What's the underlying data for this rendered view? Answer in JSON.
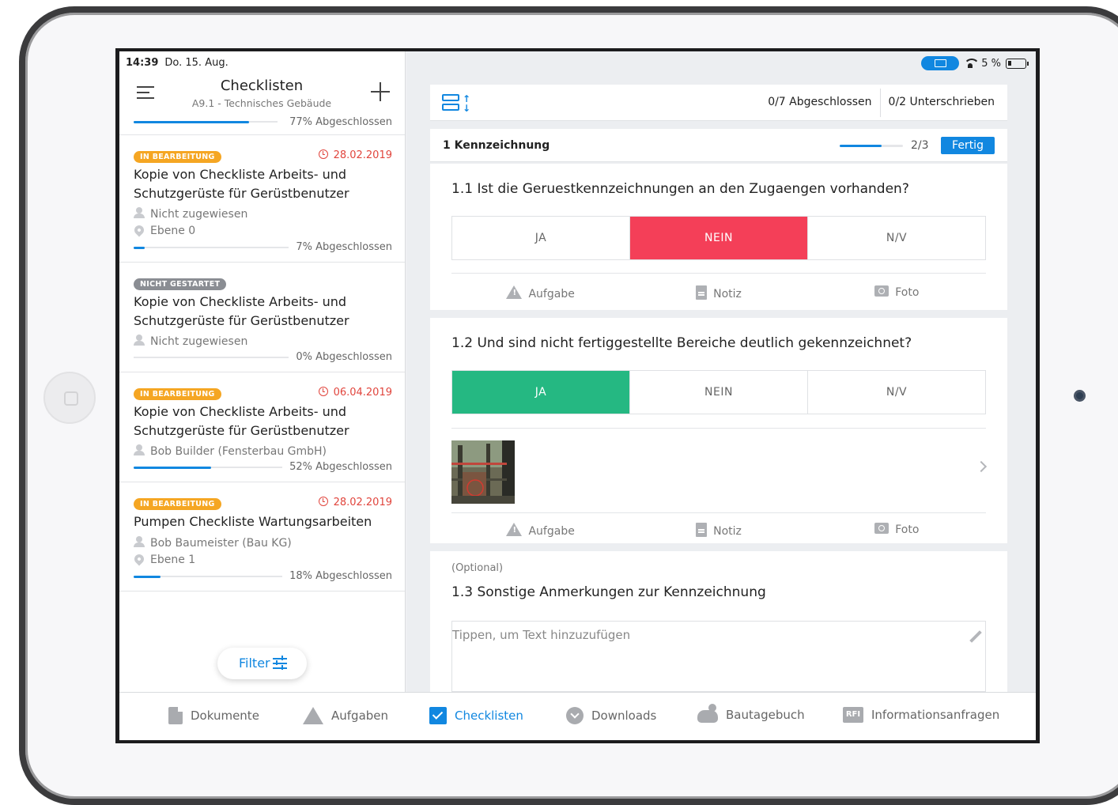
{
  "status": {
    "time": "14:39",
    "date": "Do. 15. Aug.",
    "battery": "5 %"
  },
  "header": {
    "title": "Checklisten",
    "subtitle": "A9.1 - Technisches Gebäude"
  },
  "list": {
    "top_progress_label": "77% Abgeschlossen",
    "top_progress": 0.77,
    "items": [
      {
        "badge": "IN BEARBEITUNG",
        "date": "28.02.2019",
        "title": "Kopie von Checkliste Arbeits- und Schutzgerüste für Gerüstbenutzer",
        "assignee": "Nicht zugewiesen",
        "location": "Ebene 0",
        "progress_label": "7% Abgeschlossen",
        "progress": 0.07
      },
      {
        "badge": "NICHT GESTARTET",
        "title": "Kopie von Checkliste Arbeits- und Schutzgerüste für Gerüstbenutzer",
        "assignee": "Nicht zugewiesen",
        "progress_label": "0% Abgeschlossen",
        "progress": 0.0
      },
      {
        "badge": "IN BEARBEITUNG",
        "date": "06.04.2019",
        "title": "Kopie von Checkliste Arbeits- und Schutzgerüste für Gerüstbenutzer",
        "assignee": "Bob Builder (Fensterbau GmbH)",
        "progress_label": "52% Abgeschlossen",
        "progress": 0.52
      },
      {
        "badge": "IN BEARBEITUNG",
        "date": "28.02.2019",
        "title": "Pumpen Checkliste Wartungsarbeiten",
        "assignee": "Bob Baumeister (Bau KG)",
        "location": "Ebene 1",
        "progress_label": "18% Abgeschlossen",
        "progress": 0.18
      }
    ]
  },
  "filter": {
    "label": "Filter"
  },
  "toolbar": {
    "completed": "0/7 Abgeschlossen",
    "signed": "0/2 Unterschrieben"
  },
  "section": {
    "title": "1 Kennzeichnung",
    "count": "2/3",
    "progress": 0.67,
    "done_label": "Fertig"
  },
  "questions": {
    "q1": {
      "title": "1.1 Ist die Geruestkennzeichnungen an den Zugaengen vorhanden?",
      "selected": "NEIN"
    },
    "q2": {
      "title": "1.2 Und sind nicht fertiggestellte Bereiche deutlich gekennzeichnet?",
      "selected": "JA"
    },
    "q3": {
      "optional": "(Optional)",
      "title": "1.3 Sonstige Anmerkungen zur Kennzeichnung",
      "placeholder": "Tippen, um Text hinzuzufügen"
    },
    "options": {
      "yes": "JA",
      "no": "NEIN",
      "na": "N/V"
    },
    "actions": {
      "task": "Aufgabe",
      "note": "Notiz",
      "photo": "Foto"
    }
  },
  "tabs": {
    "documents": "Dokumente",
    "tasks": "Aufgaben",
    "checklists": "Checklisten",
    "downloads": "Downloads",
    "diary": "Bautagebuch",
    "rfi_icon": "RFI",
    "rfi": "Informationsanfragen"
  },
  "colors": {
    "accent": "#1187e0",
    "no": "#f43f58",
    "yes": "#25b882",
    "in_progress": "#f5a623",
    "not_started": "#8a8d93",
    "due": "#e1453d"
  },
  "icons": [
    "menu-icon",
    "plus-icon",
    "user-icon",
    "location-pin-icon",
    "alarm-clock-icon",
    "filter-icon",
    "sort-icon",
    "warning-icon",
    "note-icon",
    "camera-icon",
    "chevron-right-icon",
    "pencil-icon",
    "document-icon",
    "checkbox-icon",
    "download-icon",
    "cloud-sun-icon",
    "rfi-icon",
    "wifi-icon",
    "battery-icon",
    "airplay-icon"
  ]
}
